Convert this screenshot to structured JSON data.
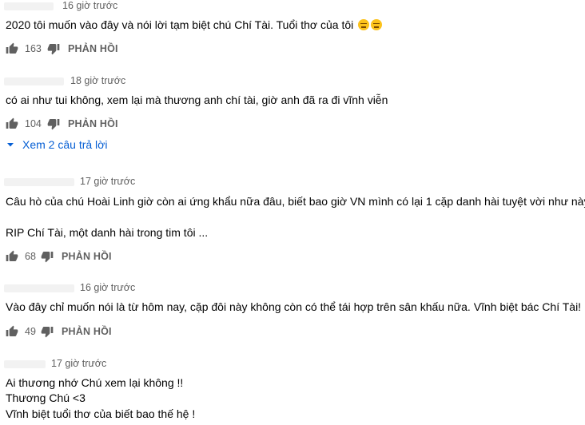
{
  "comments": [
    {
      "time": "16 giờ trước",
      "lines": [
        "2020 tôi muốn vào đây và nói lời tạm biệt chú Chí Tài. Tuổi thơ của tôi"
      ],
      "emoji": [
        "disappointed-face",
        "disappointed-face"
      ],
      "likes": "163",
      "reply_label": "PHẢN HỒI"
    },
    {
      "time": "18 giờ trước",
      "lines": [
        "có ai như tui không, xem lại mà thương anh chí tài, giờ anh đã ra đi vĩnh viễn"
      ],
      "likes": "104",
      "reply_label": "PHẢN HỒI",
      "view_replies": "Xem 2 câu trả lời"
    },
    {
      "time": "17 giờ trước",
      "lines": [
        "Câu hò của chú Hoài Linh giờ còn ai ứng khẩu nữa đâu, biết bao giờ VN mình có lại 1 cặp danh hài tuyệt vời như này ...",
        "RIP Chí Tài, một danh hài trong tim tôi ..."
      ],
      "likes": "68",
      "reply_label": "PHẢN HỒI"
    },
    {
      "time": "16 giờ trước",
      "lines": [
        "Vào đây chỉ muốn nói là từ hôm nay, cặp đôi này không còn có thể tái hợp trên sân khấu nữa. Vĩnh biệt bác Chí Tài!"
      ],
      "likes": "49",
      "reply_label": "PHẢN HỒI"
    },
    {
      "time": "17 giờ trước",
      "lines": [
        "Ai thương nhớ Chú xem lại không !!",
        "Thương Chú <3",
        "Vĩnh biệt tuổi thơ của biết bao thế hệ !"
      ]
    }
  ],
  "colors": {
    "link": "#065fd4",
    "meta": "#606060",
    "icon": "#606060"
  },
  "icons": {
    "like": "thumb-up-icon",
    "dislike": "thumb-down-icon",
    "expand": "caret-down-icon"
  }
}
